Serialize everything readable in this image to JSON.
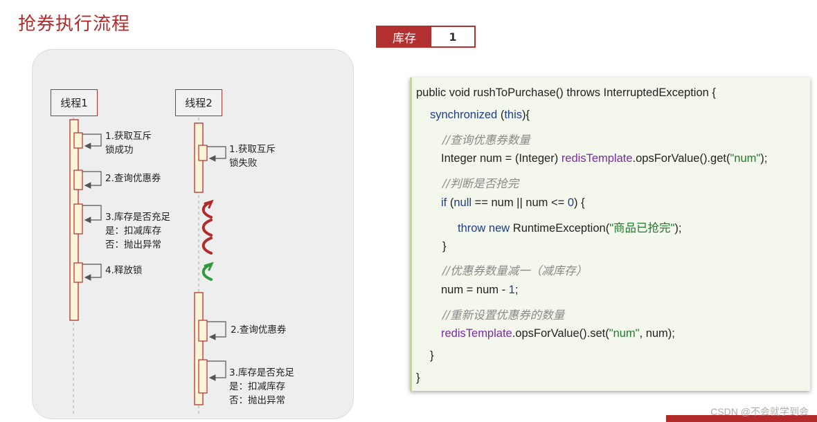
{
  "title": "抢券执行流程",
  "stock": {
    "label": "库存",
    "value": "1"
  },
  "threads": [
    {
      "name": "线程1",
      "steps": [
        [
          "1.获取互斥",
          "锁成功"
        ],
        [
          "2.查询优惠券"
        ],
        [
          "3.库存是否充足",
          "是：扣减库存",
          "否：抛出异常"
        ],
        [
          "4.释放锁"
        ]
      ]
    },
    {
      "name": "线程2",
      "steps": [
        [
          "1.获取互斥",
          "锁失败"
        ],
        [
          "2.查询优惠券"
        ],
        [
          "3.库存是否充足",
          "是：扣减库存",
          "否：抛出异常"
        ]
      ]
    }
  ],
  "code": {
    "l1": {
      "a": "public void rushToPurchase() throws InterruptedException {"
    },
    "l2": {
      "kw": "synchronized",
      "a": " (",
      "b": "this",
      "c": "){"
    },
    "l3": {
      "cm": "//查询优惠券数量"
    },
    "l4": {
      "a": "Integer num = (Integer) ",
      "fn": "redisTemplate",
      "b": ".opsForValue().get(",
      "st": "\"num\"",
      "c": ");"
    },
    "l5": {
      "cm": "//判断是否抢完"
    },
    "l6": {
      "kw": "if",
      "a": " (",
      "nl": "null",
      "b": " == num || num <= ",
      "n0": "0",
      "c": ") {"
    },
    "l7": {
      "kw": "throw new",
      "a": " RuntimeException(",
      "st": "\"商品已抢完\"",
      "b": ");"
    },
    "l8": {
      "a": "}"
    },
    "l9": {
      "cm": "//优惠券数量减一（减库存）"
    },
    "l10": {
      "a": "num = num - ",
      "n1": "1",
      "b": ";"
    },
    "l11": {
      "cm": "//重新设置优惠券的数量"
    },
    "l12": {
      "fn": "redisTemplate",
      "a": ".opsForValue().set(",
      "st": "\"num\"",
      "b": ", num);"
    },
    "l13": {
      "a": "}"
    },
    "l14": {
      "a": "}"
    }
  },
  "watermark": "CSDN @不会就学到会",
  "colors": {
    "accent": "#b23030",
    "keyword": "#1f3d8a",
    "string": "#1c7a2c",
    "field": "#7a2aa6",
    "comment": "#8a8a8a"
  }
}
